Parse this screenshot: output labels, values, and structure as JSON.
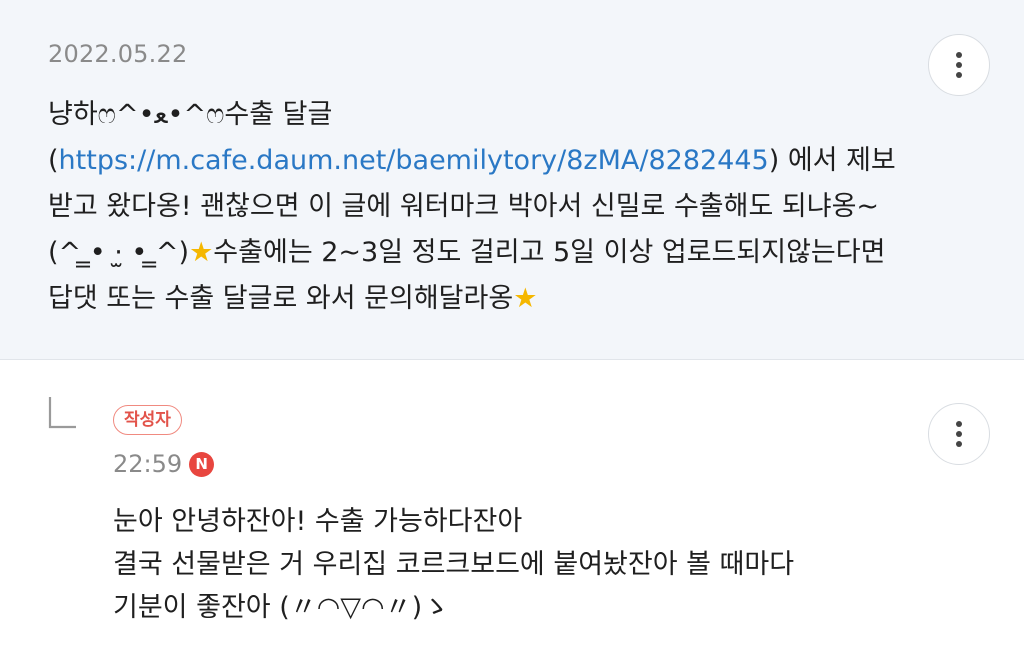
{
  "top_comment": {
    "date": "2022.05.22",
    "text_before_link": "냥하ෆ^•ﻌ•^ෆ수출 달글(",
    "link": "https://m.cafe.daum.net/baemilytory/8zMA/8282445",
    "text_after_link": ") 에서 제보받고 왔다옹! 괜찮으면 이 글에 워터마크 박아서 신밀로 수출해도 되냐옹~(^ ̳• ·̫ • ̳^)",
    "text_after_star1": "수출에는 2~3일 정도 걸리고 5일 이상 업로드되지않는다면 답댓 또는 수출 달글로 와서 문의해달라옹",
    "star_glyph": "★",
    "more_icon": "more-vertical-icon"
  },
  "reply": {
    "author_badge": "작성자",
    "time": "22:59",
    "new_badge": "N",
    "lines": [
      "눈아 안녕하잔아! 수출 가능하다잔아",
      "결국 선물받은 거 우리집 코르크보드에 붙여놨잔아 볼 때마다",
      "기분이 좋잔아 (〃◠▽◠〃)ゝ"
    ],
    "more_icon": "more-vertical-icon"
  },
  "colors": {
    "accent_link": "#2a78c5",
    "badge_red": "#e8463f",
    "top_bg": "#f3f6fa"
  }
}
